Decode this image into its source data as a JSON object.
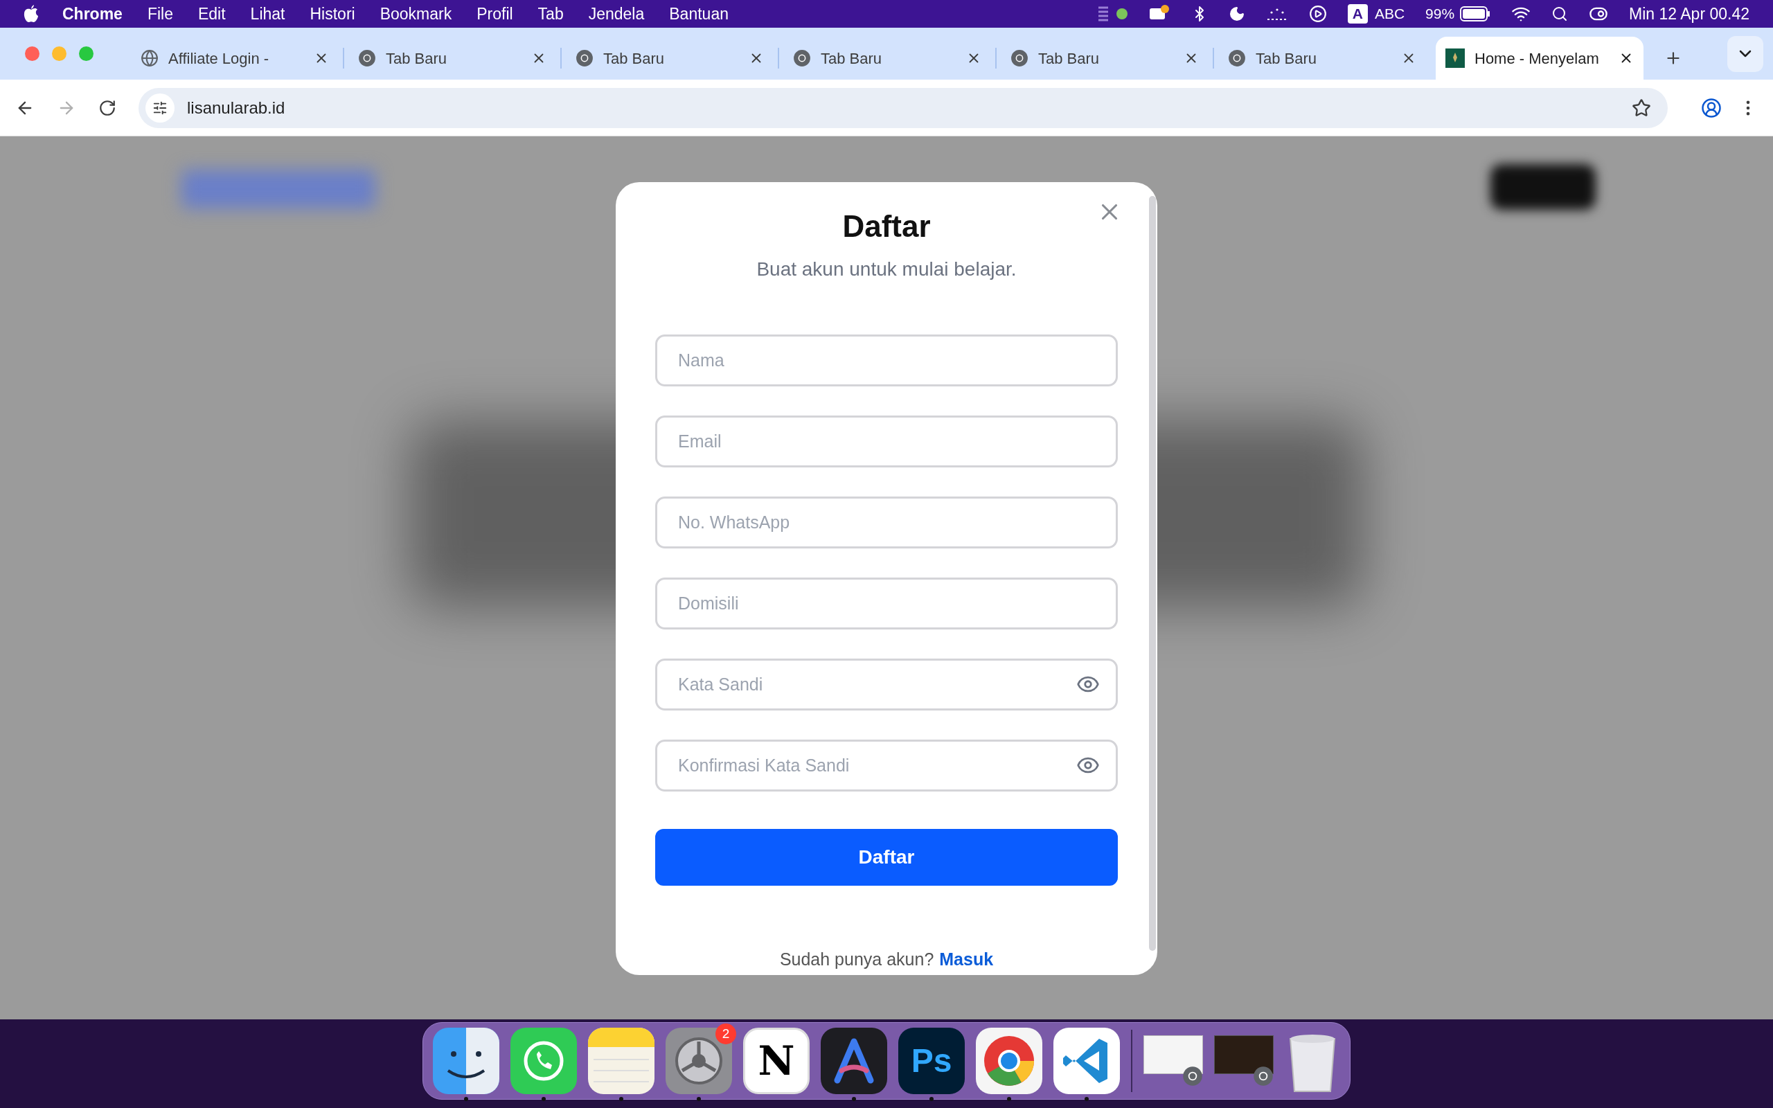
{
  "menu_bar": {
    "items": [
      {
        "label": "Chrome",
        "bold": true
      },
      {
        "label": "File",
        "bold": false
      },
      {
        "label": "Edit",
        "bold": false
      },
      {
        "label": "Lihat",
        "bold": false
      },
      {
        "label": "Histori",
        "bold": false
      },
      {
        "label": "Bookmark",
        "bold": false
      },
      {
        "label": "Profil",
        "bold": false
      },
      {
        "label": "Tab",
        "bold": false
      },
      {
        "label": "Jendela",
        "bold": false
      },
      {
        "label": "Bantuan",
        "bold": false
      }
    ],
    "input_key": "A",
    "input_source": "ABC",
    "battery": "99%",
    "clock": "Min 12 Apr 00.42"
  },
  "tabs": [
    {
      "title": "Affiliate Login -",
      "kind": "globe",
      "selected": false
    },
    {
      "title": "Tab Baru",
      "kind": "chrome",
      "selected": false
    },
    {
      "title": "Tab Baru",
      "kind": "chrome",
      "selected": false
    },
    {
      "title": "Tab Baru",
      "kind": "chrome",
      "selected": false
    },
    {
      "title": "Tab Baru",
      "kind": "chrome",
      "selected": false
    },
    {
      "title": "Tab Baru",
      "kind": "chrome",
      "selected": false
    },
    {
      "title": "Home - Menyelam",
      "kind": "site",
      "selected": true
    }
  ],
  "address_bar": {
    "url": "lisanularab.id"
  },
  "modal": {
    "title": "Daftar",
    "subtitle": "Buat akun untuk mulai belajar.",
    "fields": [
      {
        "placeholder": "Nama",
        "kind": "text"
      },
      {
        "placeholder": "Email",
        "kind": "text"
      },
      {
        "placeholder": "No. WhatsApp",
        "kind": "text"
      },
      {
        "placeholder": "Domisili",
        "kind": "text"
      },
      {
        "placeholder": "Kata Sandi",
        "kind": "password"
      },
      {
        "placeholder": "Konfirmasi Kata Sandi",
        "kind": "password"
      }
    ],
    "submit": "Daftar",
    "footer_prompt": "Sudah punya akun?",
    "footer_link": "Masuk"
  },
  "dock": [
    {
      "kind": "finder",
      "running": true
    },
    {
      "kind": "whatsapp",
      "running": true
    },
    {
      "kind": "notes",
      "running": true
    },
    {
      "kind": "settings",
      "running": true,
      "badge": "2"
    },
    {
      "kind": "notion",
      "running": false,
      "glyph": "N"
    },
    {
      "kind": "arc",
      "running": true
    },
    {
      "kind": "photoshop",
      "running": true,
      "glyph": "Ps"
    },
    {
      "kind": "chrome",
      "running": true
    },
    {
      "kind": "vscode",
      "running": true
    },
    {
      "kind": "separator"
    },
    {
      "kind": "window-preview"
    },
    {
      "kind": "window-preview"
    },
    {
      "kind": "trash"
    }
  ]
}
